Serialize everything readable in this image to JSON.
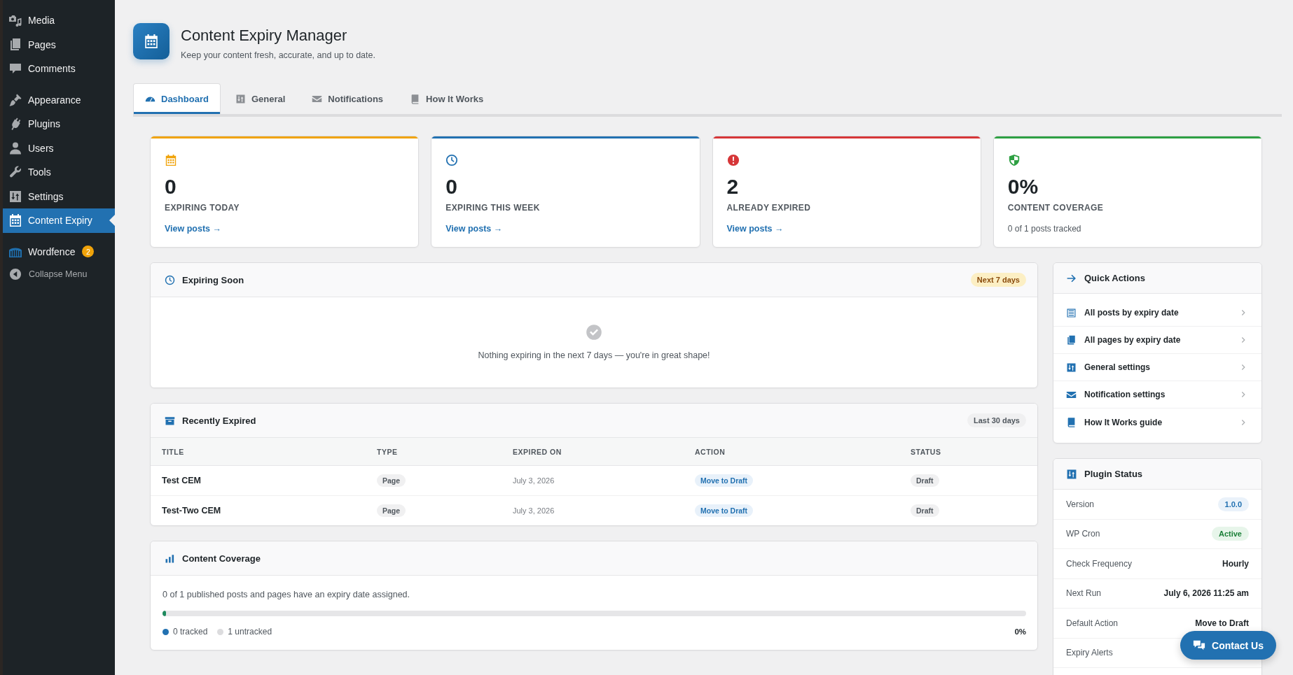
{
  "sidebar": {
    "groups": [
      {
        "items": [
          {
            "label": "Media",
            "selected": false
          },
          {
            "label": "Pages",
            "selected": false
          },
          {
            "label": "Comments",
            "selected": false
          }
        ]
      },
      {
        "items": [
          {
            "label": "Appearance",
            "selected": false
          },
          {
            "label": "Plugins",
            "selected": false
          },
          {
            "label": "Users",
            "selected": false
          },
          {
            "label": "Tools",
            "selected": false
          },
          {
            "label": "Settings",
            "selected": false
          },
          {
            "label": "Content Expiry",
            "selected": true
          }
        ]
      },
      {
        "items": [
          {
            "label": "Wordfence",
            "selected": false,
            "badge": "2"
          }
        ]
      }
    ],
    "collapse_label": "Collapse Menu"
  },
  "page_header": {
    "title": "Content Expiry Manager",
    "subtitle": "Keep your content fresh, accurate, and up to date."
  },
  "tabs": [
    {
      "label": "Dashboard",
      "selected": true
    },
    {
      "label": "General",
      "selected": false
    },
    {
      "label": "Notifications",
      "selected": false
    },
    {
      "label": "How It Works",
      "selected": false
    }
  ],
  "stat_cards": [
    {
      "value": "0",
      "label": "EXPIRING TODAY",
      "kind": "link",
      "footer": "View posts →",
      "color": "#f0a30a"
    },
    {
      "value": "0",
      "label": "EXPIRING THIS WEEK",
      "kind": "link",
      "footer": "View posts →",
      "color": "#2271b1"
    },
    {
      "value": "2",
      "label": "ALREADY EXPIRED",
      "kind": "link",
      "footer": "View posts →",
      "color": "#d63638"
    },
    {
      "value": "0%",
      "label": "CONTENT COVERAGE",
      "kind": "note",
      "footer": "0 of 1 posts tracked",
      "color": "#2ea043"
    }
  ],
  "expiring_soon": {
    "title": "Expiring Soon",
    "badge": "Next 7 days",
    "empty_message": "Nothing expiring in the next 7 days — you're in great shape!"
  },
  "recently_expired": {
    "title": "Recently Expired",
    "badge": "Last 30 days",
    "columns": [
      "TITLE",
      "TYPE",
      "EXPIRED ON",
      "ACTION",
      "STATUS"
    ],
    "rows": [
      {
        "title": "Test CEM",
        "type": "Page",
        "expired_on": "July 3, 2026",
        "action": "Move to Draft",
        "status": "Draft"
      },
      {
        "title": "Test-Two CEM",
        "type": "Page",
        "expired_on": "July 3, 2026",
        "action": "Move to Draft",
        "status": "Draft"
      }
    ]
  },
  "content_coverage": {
    "title": "Content Coverage",
    "summary": "0 of 1 published posts and pages have an expiry date assigned.",
    "level": 0,
    "legend": [
      {
        "label": "0 tracked",
        "color": "#2271b1"
      },
      {
        "label": "1 untracked",
        "color": "#dcdcde"
      }
    ],
    "percent": "0%"
  },
  "quick_actions": {
    "title": "Quick Actions",
    "items": [
      "All posts by expiry date",
      "All pages by expiry date",
      "General settings",
      "Notification settings",
      "How It Works guide"
    ]
  },
  "plugin_status": {
    "title": "Plugin Status",
    "rows": [
      {
        "label": "Version",
        "value": "1.0.0",
        "kind": "info"
      },
      {
        "label": "WP Cron",
        "value": "Active",
        "kind": "success"
      },
      {
        "label": "Check Frequency",
        "value": "Hourly",
        "kind": "text"
      },
      {
        "label": "Next Run",
        "value": "July 6, 2026 11:25 am",
        "kind": "text"
      },
      {
        "label": "Default Action",
        "value": "Move to Draft",
        "kind": "text"
      },
      {
        "label": "Expiry Alerts"
      }
    ]
  },
  "contact_button": {
    "label": "Contact Us"
  }
}
